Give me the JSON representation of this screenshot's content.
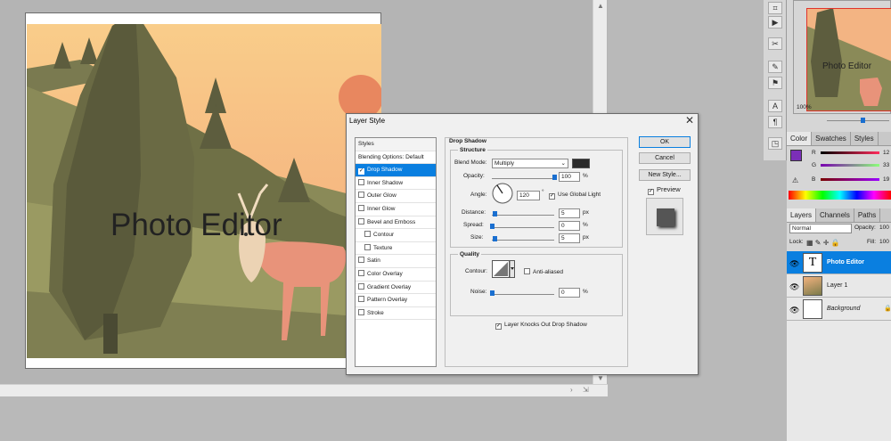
{
  "canvas": {
    "text": "Photo Editor"
  },
  "dialog": {
    "title": "Layer Style",
    "styles_header": "Styles",
    "blending_options": "Blending Options: Default",
    "style_items": [
      {
        "label": "Drop Shadow",
        "checked": true,
        "selected": true,
        "indent": false
      },
      {
        "label": "Inner Shadow",
        "checked": false,
        "selected": false,
        "indent": false
      },
      {
        "label": "Outer Glow",
        "checked": false,
        "selected": false,
        "indent": false
      },
      {
        "label": "Inner Glow",
        "checked": false,
        "selected": false,
        "indent": false
      },
      {
        "label": "Bevel and Emboss",
        "checked": false,
        "selected": false,
        "indent": false
      },
      {
        "label": "Contour",
        "checked": false,
        "selected": false,
        "indent": true
      },
      {
        "label": "Texture",
        "checked": false,
        "selected": false,
        "indent": true
      },
      {
        "label": "Satin",
        "checked": false,
        "selected": false,
        "indent": false
      },
      {
        "label": "Color Overlay",
        "checked": false,
        "selected": false,
        "indent": false
      },
      {
        "label": "Gradient Overlay",
        "checked": false,
        "selected": false,
        "indent": false
      },
      {
        "label": "Pattern Overlay",
        "checked": false,
        "selected": false,
        "indent": false
      },
      {
        "label": "Stroke",
        "checked": false,
        "selected": false,
        "indent": false
      }
    ],
    "section_title": "Drop Shadow",
    "structure": {
      "title": "Structure",
      "blend_mode_label": "Blend Mode:",
      "blend_mode_value": "Multiply",
      "shadow_color": "#2b2b2b",
      "opacity_label": "Opacity:",
      "opacity_value": "100",
      "angle_label": "Angle:",
      "angle_value": "120",
      "degree_symbol": "°",
      "use_global_light_label": "Use Global Light",
      "distance_label": "Distance:",
      "distance_value": "5",
      "spread_label": "Spread:",
      "spread_value": "0",
      "size_label": "Size:",
      "size_value": "5",
      "px_unit": "px",
      "percent_unit": "%"
    },
    "quality": {
      "title": "Quality",
      "contour_label": "Contour:",
      "anti_aliased_label": "Anti-aliased",
      "noise_label": "Noise:",
      "noise_value": "0",
      "percent_unit": "%"
    },
    "knockout_label": "Layer Knocks Out Drop Shadow",
    "ok_label": "OK",
    "cancel_label": "Cancel",
    "new_style_label": "New Style...",
    "preview_label": "Preview"
  },
  "navigator": {
    "zoom": "100%",
    "thumb_text": "Photo Editor"
  },
  "color_panel": {
    "tabs": [
      "Color",
      "Swatches",
      "Styles"
    ],
    "channels": [
      {
        "label": "R",
        "value": "12"
      },
      {
        "label": "G",
        "value": "33"
      },
      {
        "label": "B",
        "value": "19"
      }
    ]
  },
  "layers_panel": {
    "tabs": [
      "Layers",
      "Channels",
      "Paths"
    ],
    "blend_mode": "Normal",
    "opacity_label": "Opacity:",
    "opacity_value": "100",
    "lock_label": "Lock:",
    "fill_label": "Fill:",
    "fill_value": "100",
    "layers": [
      {
        "name": "Photo Editor",
        "type": "text",
        "selected": true
      },
      {
        "name": "Layer 1",
        "type": "image",
        "selected": false
      },
      {
        "name": "Background",
        "type": "background",
        "selected": false
      }
    ]
  }
}
